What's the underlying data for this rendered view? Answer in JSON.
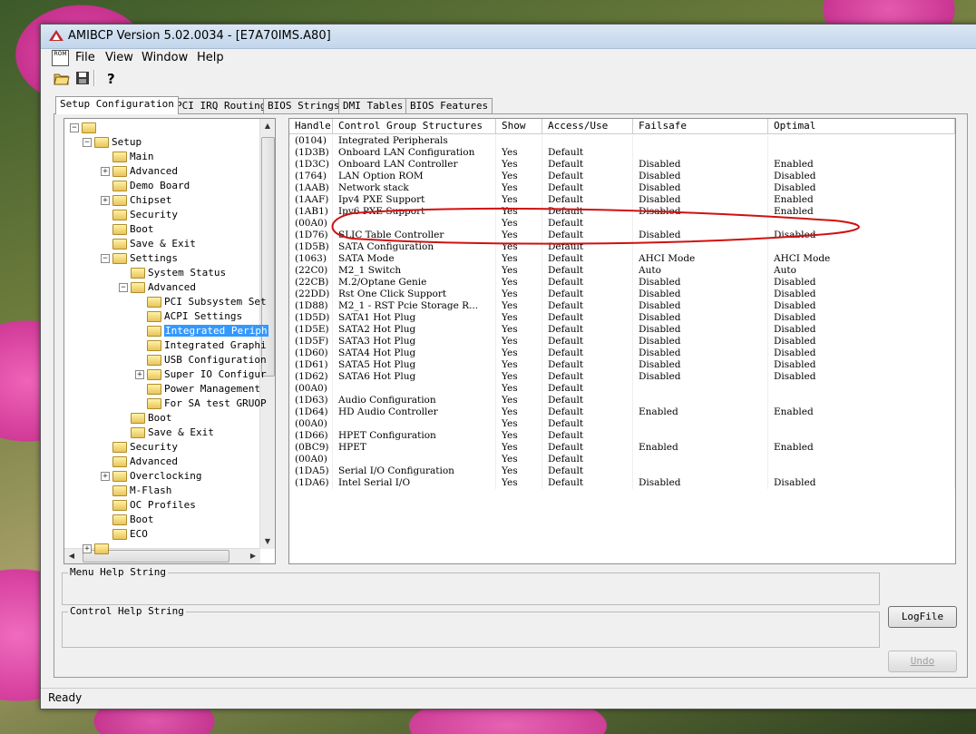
{
  "window": {
    "title": "AMIBCP Version 5.02.0034 - [E7A70IMS.A80]"
  },
  "menu": {
    "rom_label": "ROM",
    "items": [
      "File",
      "View",
      "Window",
      "Help"
    ]
  },
  "tabs": [
    "Setup Configuration",
    "PCI IRQ Routing",
    "BIOS Strings",
    "DMI Tables",
    "BIOS Features"
  ],
  "tree": [
    {
      "label": "",
      "level": 0,
      "exp": "−"
    },
    {
      "label": "Setup",
      "level": 1,
      "exp": "−"
    },
    {
      "label": "Main",
      "level": 2,
      "exp": ""
    },
    {
      "label": "Advanced",
      "level": 2,
      "exp": "+"
    },
    {
      "label": "Demo Board",
      "level": 2,
      "exp": ""
    },
    {
      "label": "Chipset",
      "level": 2,
      "exp": "+"
    },
    {
      "label": "Security",
      "level": 2,
      "exp": ""
    },
    {
      "label": "Boot",
      "level": 2,
      "exp": ""
    },
    {
      "label": "Save & Exit",
      "level": 2,
      "exp": ""
    },
    {
      "label": "Settings",
      "level": 2,
      "exp": "−"
    },
    {
      "label": "System Status",
      "level": 3,
      "exp": ""
    },
    {
      "label": "Advanced",
      "level": 3,
      "exp": "−"
    },
    {
      "label": "PCI Subsystem Set",
      "level": 4,
      "exp": ""
    },
    {
      "label": "ACPI Settings",
      "level": 4,
      "exp": ""
    },
    {
      "label": "Integrated Periph",
      "level": 4,
      "exp": "",
      "selected": true
    },
    {
      "label": "Integrated Graphi",
      "level": 4,
      "exp": ""
    },
    {
      "label": "USB Configuration",
      "level": 4,
      "exp": ""
    },
    {
      "label": "Super IO Configur",
      "level": 4,
      "exp": "+"
    },
    {
      "label": "Power Management",
      "level": 4,
      "exp": ""
    },
    {
      "label": "For SA test GRUOP",
      "level": 4,
      "exp": ""
    },
    {
      "label": "Boot",
      "level": 3,
      "exp": ""
    },
    {
      "label": "Save & Exit",
      "level": 3,
      "exp": ""
    },
    {
      "label": "Security",
      "level": 2,
      "exp": ""
    },
    {
      "label": "Advanced",
      "level": 2,
      "exp": ""
    },
    {
      "label": "Overclocking",
      "level": 2,
      "exp": "+"
    },
    {
      "label": "M-Flash",
      "level": 2,
      "exp": ""
    },
    {
      "label": "OC Profiles",
      "level": 2,
      "exp": ""
    },
    {
      "label": "Boot",
      "level": 2,
      "exp": ""
    },
    {
      "label": "ECO",
      "level": 2,
      "exp": ""
    },
    {
      "label": "",
      "level": 1,
      "exp": "+"
    }
  ],
  "grid": {
    "columns": [
      "Handle",
      "Control Group Structures",
      "Show",
      "Access/Use",
      "Failsafe",
      "Optimal"
    ],
    "rows": [
      [
        "(0104)",
        "Integrated Peripherals",
        "",
        "",
        "",
        ""
      ],
      [
        "(1D3B)",
        "Onboard LAN Configuration",
        "Yes",
        "Default",
        "",
        ""
      ],
      [
        "(1D3C)",
        "Onboard LAN Controller",
        "Yes",
        "Default",
        "Disabled",
        "Enabled"
      ],
      [
        "(1764)",
        "LAN Option ROM",
        "Yes",
        "Default",
        "Disabled",
        "Disabled"
      ],
      [
        "(1AAB)",
        "Network stack",
        "Yes",
        "Default",
        "Disabled",
        "Disabled"
      ],
      [
        "(1AAF)",
        "Ipv4 PXE Support",
        "Yes",
        "Default",
        "Disabled",
        "Enabled"
      ],
      [
        "(1AB1)",
        "Ipv6 PXE Support",
        "Yes",
        "Default",
        "Disabled",
        "Enabled"
      ],
      [
        "(00A0)",
        "",
        "Yes",
        "Default",
        "",
        ""
      ],
      [
        "(1D76)",
        "SLIC Table Controller",
        "Yes",
        "Default",
        "Disabled",
        "Disabled"
      ],
      [
        "(1D5B)",
        "SATA Configuration",
        "Yes",
        "Default",
        "",
        ""
      ],
      [
        "(1063)",
        "SATA Mode",
        "Yes",
        "Default",
        "AHCI Mode",
        "AHCI Mode"
      ],
      [
        "(22C0)",
        "M2_1 Switch",
        "Yes",
        "Default",
        "Auto",
        "Auto"
      ],
      [
        "(22CB)",
        "M.2/Optane Genie",
        "Yes",
        "Default",
        "Disabled",
        "Disabled"
      ],
      [
        "(22DD)",
        "Rst One Click Support",
        "Yes",
        "Default",
        "Disabled",
        "Disabled"
      ],
      [
        "(1D88)",
        "M2_1 - RST Pcie Storage R...",
        "Yes",
        "Default",
        "Disabled",
        "Disabled"
      ],
      [
        "(1D5D)",
        "SATA1 Hot Plug",
        "Yes",
        "Default",
        "Disabled",
        "Disabled"
      ],
      [
        "(1D5E)",
        "SATA2 Hot Plug",
        "Yes",
        "Default",
        "Disabled",
        "Disabled"
      ],
      [
        "(1D5F)",
        "SATA3 Hot Plug",
        "Yes",
        "Default",
        "Disabled",
        "Disabled"
      ],
      [
        "(1D60)",
        "SATA4 Hot Plug",
        "Yes",
        "Default",
        "Disabled",
        "Disabled"
      ],
      [
        "(1D61)",
        "SATA5 Hot Plug",
        "Yes",
        "Default",
        "Disabled",
        "Disabled"
      ],
      [
        "(1D62)",
        "SATA6 Hot Plug",
        "Yes",
        "Default",
        "Disabled",
        "Disabled"
      ],
      [
        "(00A0)",
        "",
        "Yes",
        "Default",
        "",
        ""
      ],
      [
        "(1D63)",
        "Audio Configuration",
        "Yes",
        "Default",
        "",
        ""
      ],
      [
        "(1D64)",
        "HD Audio Controller",
        "Yes",
        "Default",
        "Enabled",
        "Enabled"
      ],
      [
        "(00A0)",
        "",
        "Yes",
        "Default",
        "",
        ""
      ],
      [
        "(1D66)",
        "HPET Configuration",
        "Yes",
        "Default",
        "",
        ""
      ],
      [
        "(0BC9)",
        "HPET",
        "Yes",
        "Default",
        "Enabled",
        "Enabled"
      ],
      [
        "(00A0)",
        "",
        "Yes",
        "Default",
        "",
        ""
      ],
      [
        "(1DA5)",
        "Serial I/O Configuration",
        "Yes",
        "Default",
        "",
        ""
      ],
      [
        "(1DA6)",
        "Intel Serial I/O",
        "Yes",
        "Default",
        "Disabled",
        "Disabled"
      ]
    ]
  },
  "help": {
    "menu_label": "Menu Help String",
    "control_label": "Control Help String",
    "logfile_button": "LogFile",
    "undo_button": "Undo"
  },
  "status": {
    "text": "Ready"
  },
  "icons": [
    "open-folder-icon",
    "save-disk-icon",
    "help-question-icon",
    "ami-logo-icon",
    "rom-icon"
  ],
  "colors": {
    "selection": "#3399ff",
    "annotation": "#d01010"
  }
}
